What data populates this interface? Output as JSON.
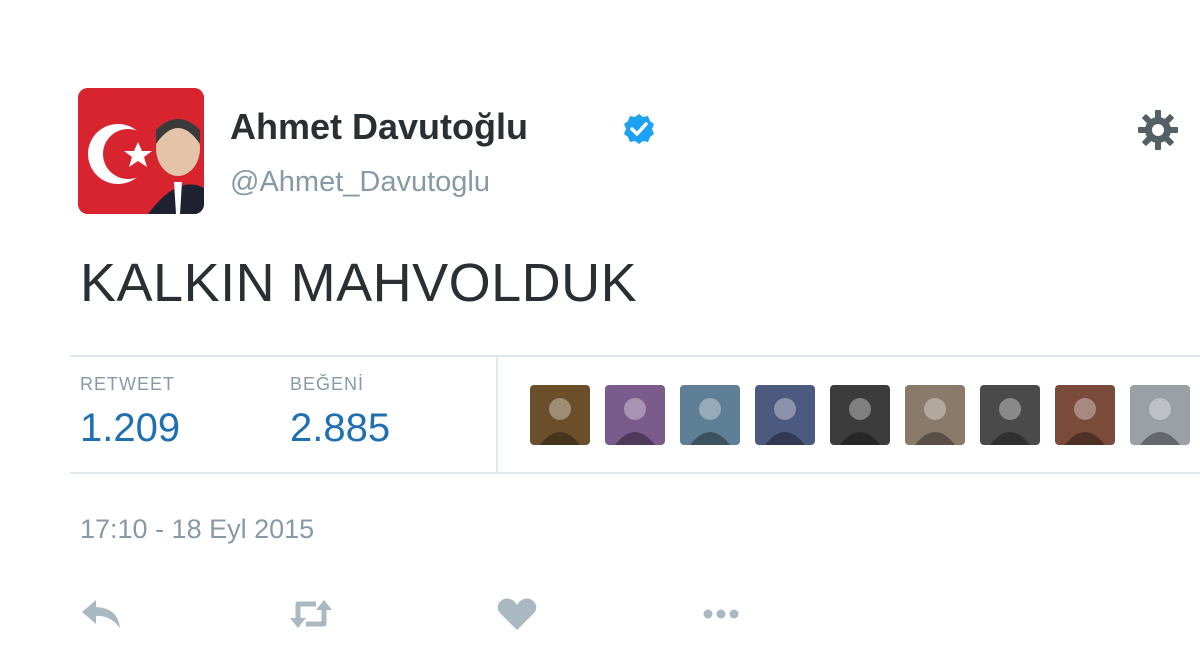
{
  "tweet": {
    "author": {
      "display_name": "Ahmet Davutoğlu",
      "handle": "@Ahmet_Davutoglu",
      "verified_icon": "verified-badge-icon",
      "avatar_colors": {
        "flag_red": "#d8242e",
        "flag_white": "#ffffff"
      }
    },
    "text": "KALKIN MAHVOLDUK",
    "stats": {
      "retweets_label": "RETWEET",
      "retweets_value": "1.209",
      "likes_label": "BEĞENİ",
      "likes_value": "2.885"
    },
    "liker_avatars": [
      {
        "color": "#6b4f2a"
      },
      {
        "color": "#7b5a8c"
      },
      {
        "color": "#5f7f96"
      },
      {
        "color": "#4d5a80"
      },
      {
        "color": "#3c3c3c"
      },
      {
        "color": "#8a7a6a"
      },
      {
        "color": "#4a4a4a"
      },
      {
        "color": "#7a4a3a"
      },
      {
        "color": "#9aa0a6"
      }
    ],
    "timestamp": "17:10 - 18 Eyl 2015",
    "actions": {
      "reply_icon": "reply-icon",
      "retweet_icon": "retweet-icon",
      "like_icon": "heart-icon",
      "more_icon": "more-dots-icon"
    },
    "theme": {
      "text_color": "#292f33",
      "muted_color": "#8899a6",
      "accent_color": "#1f6fb3",
      "verified_color": "#1da1f2",
      "action_color": "#aab8c2"
    }
  }
}
